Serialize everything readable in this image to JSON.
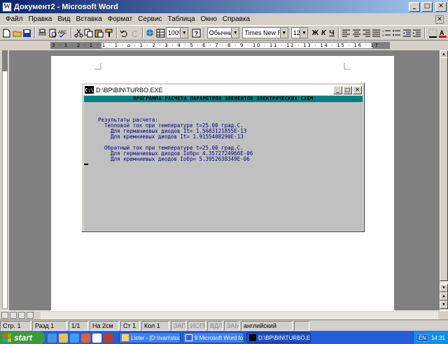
{
  "window": {
    "title": "Документ2 - Microsoft Word"
  },
  "menu": [
    "Файл",
    "Правка",
    "Вид",
    "Вставка",
    "Формат",
    "Сервис",
    "Таблица",
    "Окно",
    "Справка"
  ],
  "toolbar": {
    "zoom": "100%",
    "style": "Обычный",
    "font": "Times New Roman",
    "size": "12",
    "bold": "Ж",
    "italic": "К",
    "underline": "Ч"
  },
  "ruler": {
    "marks": "3 · 1 · 2 · 1 · 1 · 1 · ⌂ · 1 · 2 · 3 · 4 · 5 · 6 · 7 · 8 · 9 · 10 · 11 · 12 · 13 · 14 · 15 · 16 · 17 ·"
  },
  "dos_window": {
    "title": "D:\\BP\\BIN\\TURBO.EXE",
    "header": "ПРОГРАММА РАСЧЕТА ПАРАМЕТРОВ ЭЛЕМЕНТОВ ЭЛЕКТРИЧЕСКИХ СХЕМ",
    "lines": [
      "Результаты расчета:",
      "  Тепловой ток при температуре t=25.00 град.С.",
      "    Для германиевых диодов It= 1.5683121855E-13",
      "    Для кремниевых диодов It= 1.9155408290E-13",
      "",
      "  Обратный ток при температуре t=25.00 град.С.",
      "    Для германиевых диодов Iобр= 4.3572724966E-06",
      "    Для кремниевых диодов Iобр= 5.3952638349E-06"
    ]
  },
  "statusbar": {
    "page": "Стр. 1",
    "section": "Разд 1",
    "pages": "1/1",
    "at": "На 2см",
    "line": "Ст 1",
    "col": "Кол 1",
    "rec": "ЗАП",
    "trk": "ИСПР",
    "ext": "ВДЛ",
    "ovr": "ЗАМ",
    "lang": "английский"
  },
  "taskbar": {
    "start": "start",
    "tasks": [
      "Lister - [D:\\Ivan\\stud...",
      "9 Microsoft Word fo...",
      "D:\\BP\\BIN\\TURBO.EXE"
    ],
    "lang": "EN",
    "clock": "14:31"
  },
  "colors": {
    "titlebar": "#0a246a",
    "console_bg": "#c0c0c0",
    "console_band": "#008080",
    "console_text": "#000080",
    "taskbar": "#245edb"
  }
}
